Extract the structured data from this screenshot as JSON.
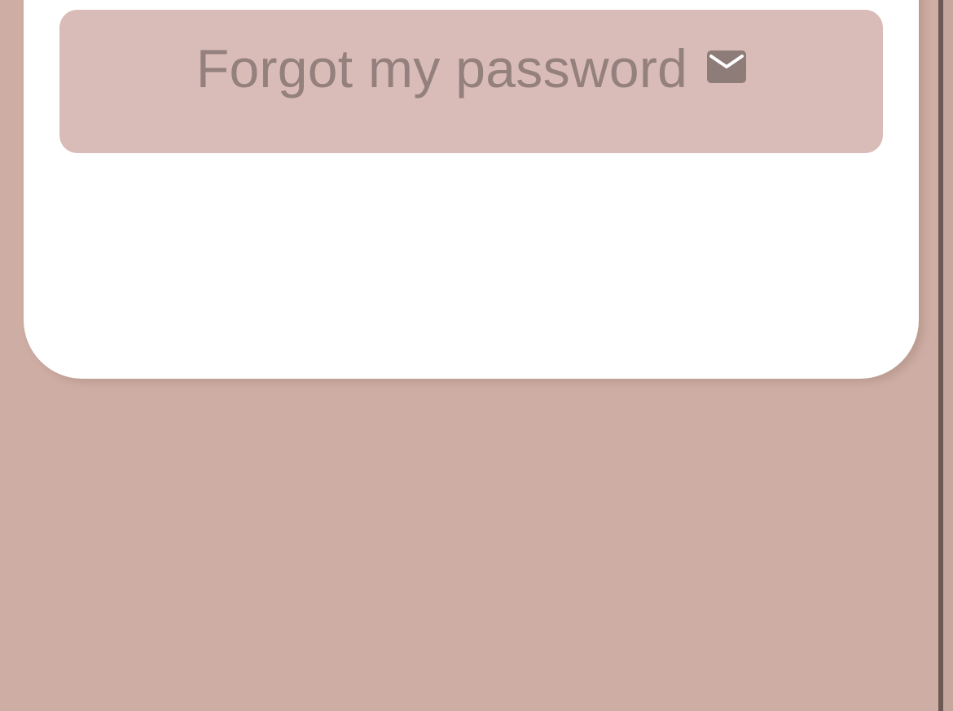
{
  "forgot_password": {
    "label": "Forgot my password",
    "icon": "mail-icon"
  },
  "colors": {
    "background": "#ceaea4",
    "card": "#ffffff",
    "button": "#d9bcb7",
    "button_text": "#94807c",
    "scrollbar": "#6d5953"
  }
}
